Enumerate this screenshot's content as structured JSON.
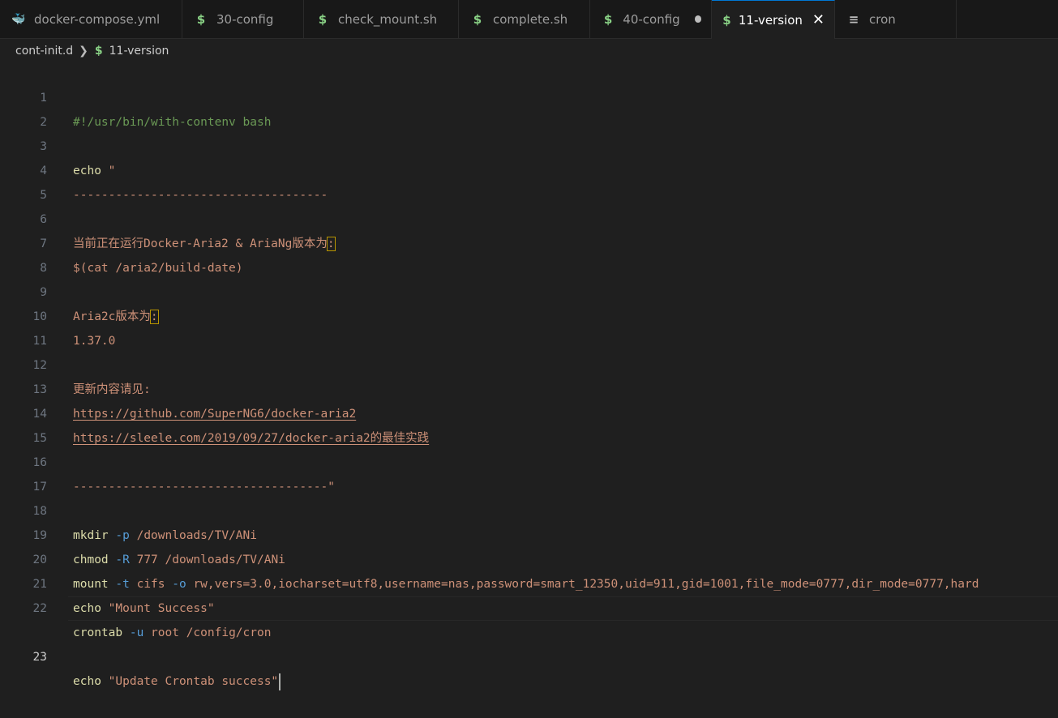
{
  "tabs": [
    {
      "label": "docker-compose.yml",
      "icon": "docker-icon"
    },
    {
      "label": "30-config",
      "icon": "shell-icon"
    },
    {
      "label": "check_mount.sh",
      "icon": "shell-icon"
    },
    {
      "label": "complete.sh",
      "icon": "shell-icon"
    },
    {
      "label": "40-config",
      "icon": "shell-icon",
      "modified": true
    },
    {
      "label": "11-version",
      "icon": "shell-icon",
      "active": true
    },
    {
      "label": "cron",
      "icon": "text-icon"
    }
  ],
  "breadcrumb": {
    "folder": "cont-init.d",
    "file": "11-version"
  },
  "editor": {
    "current_line": 23,
    "line_numbers": [
      "1",
      "2",
      "3",
      "4",
      "5",
      "6",
      "7",
      "8",
      "9",
      "10",
      "11",
      "12",
      "13",
      "14",
      "15",
      "16",
      "17",
      "18",
      "19",
      "20",
      "21",
      "22",
      "23"
    ],
    "l1": "#!/usr/bin/with-contenv bash",
    "l3_cmd": "echo",
    "l3_str": " \"",
    "l4": "------------------------------------",
    "l6_text": "当前正在运行Docker-Aria2 & AriaNg版本为",
    "l6_colon": ":",
    "l7": "$(cat /aria2/build-date)",
    "l9_text": "Aria2c版本为",
    "l9_colon": ":",
    "l10": "1.37.0",
    "l12": "更新内容请见:",
    "l13": "https://github.com/SuperNG6/docker-aria2",
    "l14": "https://sleele.com/2019/09/27/docker-aria2的最佳实践",
    "l16": "------------------------------------\"",
    "l18_cmd": "mkdir",
    "l18_flag": " -p",
    "l18_arg": " /downloads/TV/ANi",
    "l19_cmd": "chmod",
    "l19_flag": " -R",
    "l19_arg": " 777 /downloads/TV/ANi",
    "l20_cmd": "mount",
    "l20_flag1": " -t",
    "l20_arg1": " cifs",
    "l20_flag2": " -o",
    "l20_arg2": " rw,vers=3.0,iocharset=utf8,username=nas,password=smart_12350,uid=911,gid=1001,file_mode=0777,dir_mode=0777,hard",
    "l21_cmd": "echo",
    "l21_str": " \"Mount Success\"",
    "l22_cmd": "crontab",
    "l22_flag": " -u",
    "l22_arg": " root /config/cron",
    "l23_cmd": "echo",
    "l23_str": " \"Update Crontab success\""
  },
  "colors": {
    "background": "#1f1f1f",
    "tabbar": "#181818",
    "accent": "#0078d4",
    "string": "#ce9178",
    "keyword": "#dcdcaa",
    "flag": "#569cd6",
    "comment": "#6a9955",
    "shell_icon": "#89d185"
  }
}
